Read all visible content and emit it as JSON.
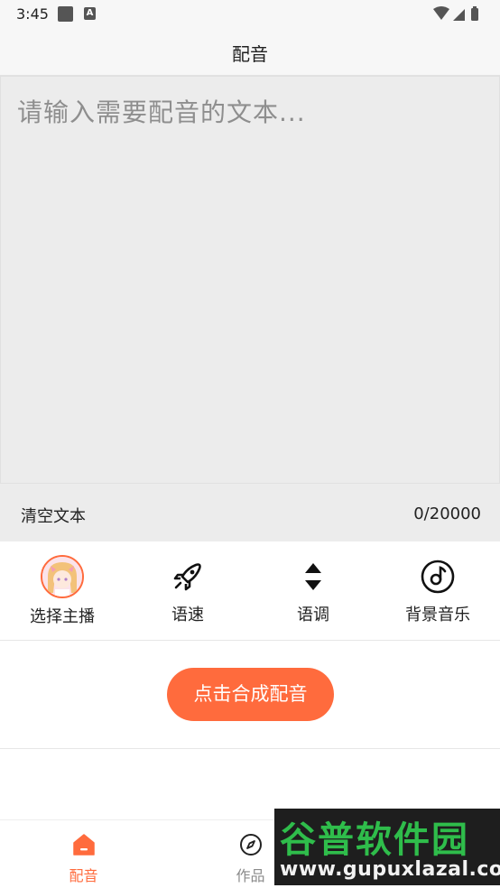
{
  "status_bar": {
    "time": "3:45",
    "notification_icons": [
      "square-icon",
      "text-a-icon"
    ],
    "system_icons": [
      "wifi-icon",
      "signal-icon",
      "battery-icon"
    ]
  },
  "header": {
    "title": "配音"
  },
  "editor": {
    "placeholder": "请输入需要配音的文本...",
    "clear_label": "清空文本",
    "char_count": "0/20000"
  },
  "options": [
    {
      "label": "选择主播",
      "icon": "avatar"
    },
    {
      "label": "语速",
      "icon": "rocket-icon"
    },
    {
      "label": "语调",
      "icon": "up-down-icon"
    },
    {
      "label": "背景音乐",
      "icon": "music-disc-icon"
    }
  ],
  "synth": {
    "button_label": "点击合成配音"
  },
  "bottom_nav": [
    {
      "label": "配音",
      "icon": "home-icon",
      "active": true
    },
    {
      "label": "作品",
      "icon": "compass-icon",
      "active": false
    }
  ],
  "watermark": {
    "logo": "谷普软件园",
    "url": "www.gupuxlazal.com"
  },
  "colors": {
    "accent": "#ff6b3d",
    "editor_bg": "#ececec",
    "header_bg": "#f7f7f7",
    "watermark_green": "#2fbd4b"
  }
}
